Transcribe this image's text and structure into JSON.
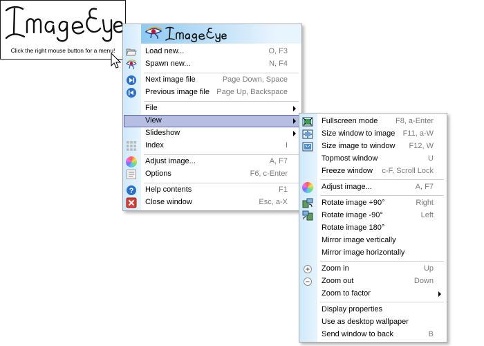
{
  "app": {
    "logo_text": "Image Eye",
    "hint": "Click the right mouse button for a menu!"
  },
  "colors": {
    "highlight": "#b6bfe1",
    "highlight_border": "#5a5fa6",
    "icon_strip": "#d7edfb",
    "shortcut_text": "#7a7a7a"
  },
  "main_menu": {
    "header_logo": "Image Eye",
    "items": [
      {
        "label": "Load new...",
        "shortcut": "O, F3",
        "icon": "folder-open-icon"
      },
      {
        "label": "Spawn new...",
        "shortcut": "N, F4",
        "icon": "eye-icon"
      },
      {
        "label": "Next image file",
        "shortcut": "Page Down, Space",
        "icon": "next-icon"
      },
      {
        "label": "Previous image file",
        "shortcut": "Page Up, Backspace",
        "icon": "previous-icon"
      },
      {
        "label": "File",
        "shortcut": "",
        "icon": ""
      },
      {
        "label": "View",
        "shortcut": "",
        "icon": ""
      },
      {
        "label": "Slideshow",
        "shortcut": "",
        "icon": ""
      },
      {
        "label": "Index",
        "shortcut": "I",
        "icon": "grid-icon"
      },
      {
        "label": "Adjust image...",
        "shortcut": "A, F7",
        "icon": "color-wheel-icon"
      },
      {
        "label": "Options",
        "shortcut": "F6, c-Enter",
        "icon": "options-icon"
      },
      {
        "label": "Help contents",
        "shortcut": "F1",
        "icon": "help-icon"
      },
      {
        "label": "Close window",
        "shortcut": "Esc, a-X",
        "icon": "close-icon"
      }
    ]
  },
  "view_menu": {
    "items": [
      {
        "label": "Fullscreen mode",
        "shortcut": "F8, a-Enter",
        "icon": "fullscreen-icon"
      },
      {
        "label": "Size window to image",
        "shortcut": "F11, a-W",
        "icon": "size-window-icon"
      },
      {
        "label": "Size image to window",
        "shortcut": "F12, W",
        "icon": "size-image-icon"
      },
      {
        "label": "Topmost window",
        "shortcut": "U",
        "icon": ""
      },
      {
        "label": "Freeze window",
        "shortcut": "c-F, Scroll Lock",
        "icon": ""
      },
      {
        "label": "Adjust image...",
        "shortcut": "A, F7",
        "icon": "color-wheel-icon"
      },
      {
        "label": "Rotate image +90°",
        "shortcut": "Right",
        "icon": "rotate-cw-icon"
      },
      {
        "label": "Rotate image -90°",
        "shortcut": "Left",
        "icon": "rotate-ccw-icon"
      },
      {
        "label": "Rotate image 180°",
        "shortcut": "",
        "icon": ""
      },
      {
        "label": "Mirror image vertically",
        "shortcut": "",
        "icon": ""
      },
      {
        "label": "Mirror image horizontally",
        "shortcut": "",
        "icon": ""
      },
      {
        "label": "Zoom in",
        "shortcut": "Up",
        "icon": "zoom-in-icon"
      },
      {
        "label": "Zoom out",
        "shortcut": "Down",
        "icon": "zoom-out-icon"
      },
      {
        "label": "Zoom to factor",
        "shortcut": "",
        "icon": ""
      },
      {
        "label": "Display properties",
        "shortcut": "",
        "icon": ""
      },
      {
        "label": "Use as desktop wallpaper",
        "shortcut": "",
        "icon": ""
      },
      {
        "label": "Send window to back",
        "shortcut": "B",
        "icon": ""
      }
    ]
  }
}
